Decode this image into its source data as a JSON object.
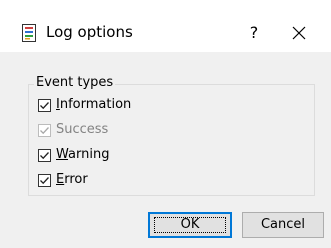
{
  "window": {
    "title": "Log options",
    "help_glyph": "?",
    "close_glyph": "✕"
  },
  "group": {
    "label": "Event types"
  },
  "checkboxes": [
    {
      "mnemonic": "I",
      "rest": "nformation",
      "checked": true,
      "enabled": true
    },
    {
      "mnemonic": "",
      "rest": "Success",
      "checked": true,
      "enabled": false
    },
    {
      "mnemonic": "W",
      "rest": "arning",
      "checked": true,
      "enabled": true
    },
    {
      "mnemonic": "E",
      "rest": "rror",
      "checked": true,
      "enabled": true
    }
  ],
  "buttons": {
    "ok_label": "OK",
    "cancel_label": "Cancel"
  },
  "icons": {
    "title": "log-document-icon",
    "close": "close-icon",
    "check": "checkmark-icon"
  },
  "colors": {
    "accent": "#0078d7",
    "disabled_text": "#838383"
  }
}
